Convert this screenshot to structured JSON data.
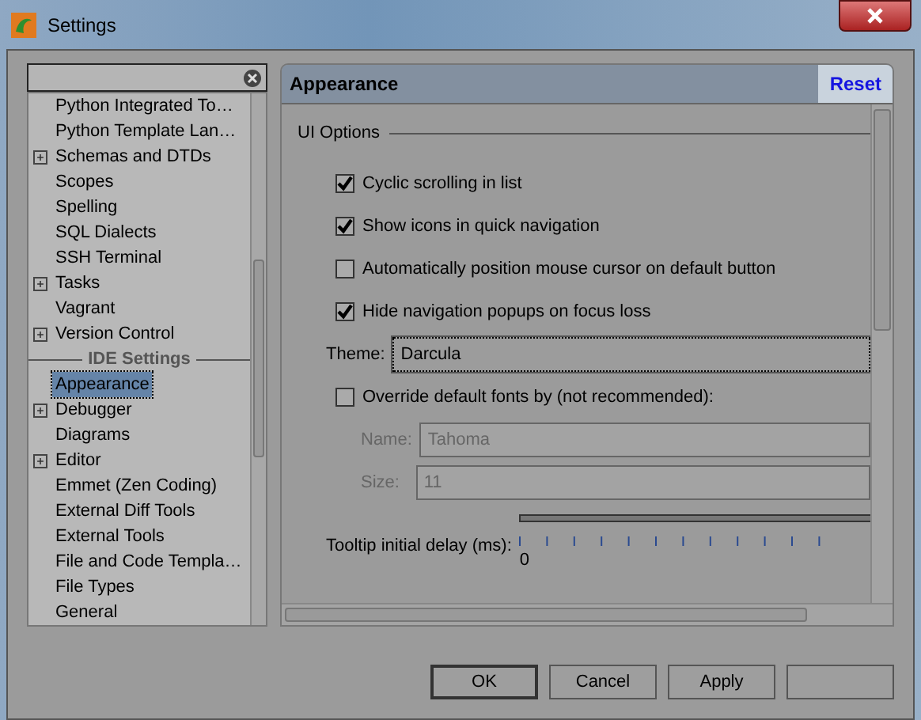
{
  "window": {
    "title": "Settings"
  },
  "tree": [
    {
      "kind": "item",
      "label": "Python Integrated To…",
      "expandable": false,
      "selected": false
    },
    {
      "kind": "item",
      "label": "Python Template Lan…",
      "expandable": false,
      "selected": false
    },
    {
      "kind": "item",
      "label": "Schemas and DTDs",
      "expandable": true,
      "selected": false
    },
    {
      "kind": "item",
      "label": "Scopes",
      "expandable": false,
      "selected": false
    },
    {
      "kind": "item",
      "label": "Spelling",
      "expandable": false,
      "selected": false
    },
    {
      "kind": "item",
      "label": "SQL Dialects",
      "expandable": false,
      "selected": false
    },
    {
      "kind": "item",
      "label": "SSH Terminal",
      "expandable": false,
      "selected": false
    },
    {
      "kind": "item",
      "label": "Tasks",
      "expandable": true,
      "selected": false
    },
    {
      "kind": "item",
      "label": "Vagrant",
      "expandable": false,
      "selected": false
    },
    {
      "kind": "item",
      "label": "Version Control",
      "expandable": true,
      "selected": false
    },
    {
      "kind": "header",
      "label": "IDE Settings"
    },
    {
      "kind": "item",
      "label": "Appearance",
      "expandable": false,
      "selected": true
    },
    {
      "kind": "item",
      "label": "Debugger",
      "expandable": true,
      "selected": false
    },
    {
      "kind": "item",
      "label": "Diagrams",
      "expandable": false,
      "selected": false
    },
    {
      "kind": "item",
      "label": "Editor",
      "expandable": true,
      "selected": false
    },
    {
      "kind": "item",
      "label": "Emmet (Zen Coding)",
      "expandable": false,
      "selected": false
    },
    {
      "kind": "item",
      "label": "External Diff Tools",
      "expandable": false,
      "selected": false
    },
    {
      "kind": "item",
      "label": "External Tools",
      "expandable": false,
      "selected": false
    },
    {
      "kind": "item",
      "label": "File and Code Templa…",
      "expandable": false,
      "selected": false
    },
    {
      "kind": "item",
      "label": "File Types",
      "expandable": false,
      "selected": false
    },
    {
      "kind": "item",
      "label": "General",
      "expandable": false,
      "selected": false
    }
  ],
  "panel": {
    "title": "Appearance",
    "reset": "Reset"
  },
  "section": "UI Options",
  "options": [
    {
      "kind": "checkbox",
      "label": "Cyclic scrolling in list",
      "checked": true
    },
    {
      "kind": "checkbox",
      "label": "Show icons in quick navigation",
      "checked": true
    },
    {
      "kind": "checkbox",
      "label": "Automatically position mouse cursor on default button",
      "checked": false
    },
    {
      "kind": "checkbox",
      "label": "Hide navigation popups on focus loss",
      "checked": true
    },
    {
      "kind": "select",
      "label": "Theme:",
      "value": "Darcula"
    },
    {
      "kind": "checkbox",
      "label": "Override default fonts by (not recommended):",
      "checked": false
    },
    {
      "kind": "field",
      "label": "Name:",
      "value": "Tahoma",
      "disabled": true
    },
    {
      "kind": "field",
      "label": "Size:",
      "value": "11",
      "disabled": true
    },
    {
      "kind": "slider",
      "label": "Tooltip initial delay (ms):",
      "tick_label": "0"
    }
  ],
  "buttons": [
    {
      "label": "OK",
      "default": true
    },
    {
      "label": "Cancel",
      "default": false
    },
    {
      "label": "Apply",
      "default": false
    }
  ]
}
